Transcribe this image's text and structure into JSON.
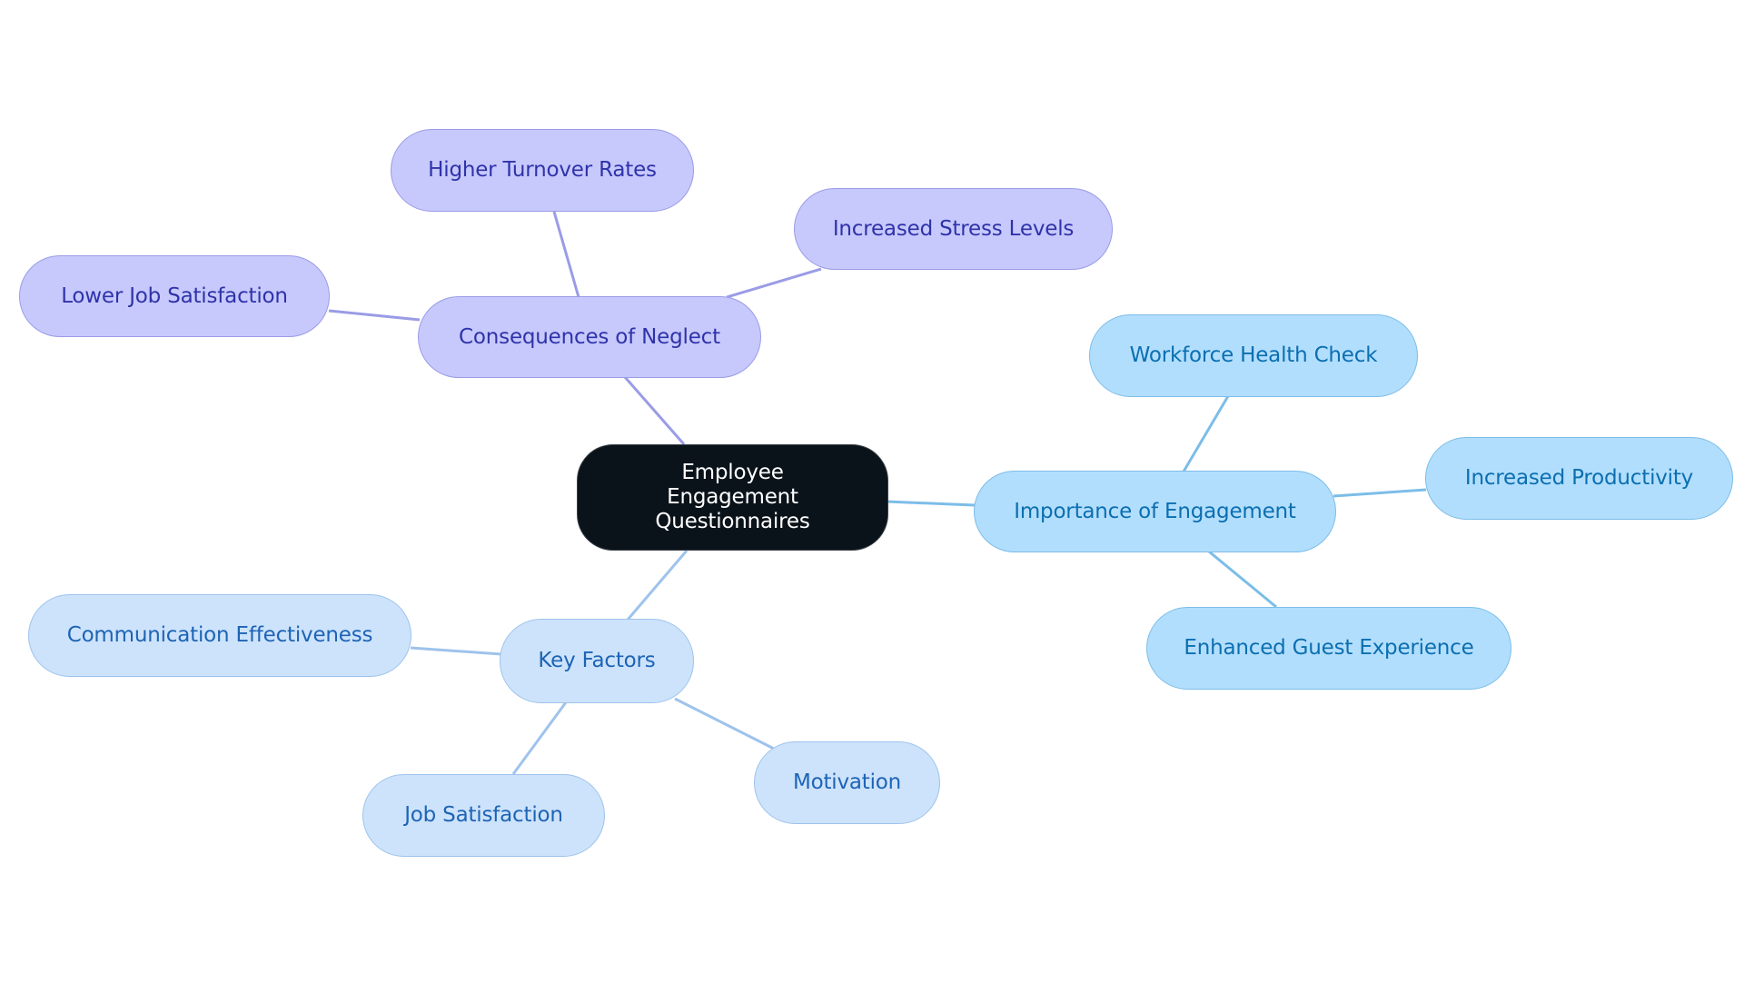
{
  "diagram": {
    "type": "mind-map",
    "root": {
      "id": "root",
      "label": "Employee Engagement Questionnaires"
    },
    "colors": {
      "root_fill": "#0b131a",
      "root_text": "#ffffff",
      "purple_fill": "#c7c9fd",
      "purple_stroke": "#9a9ce6",
      "purple_text": "#2f33a8",
      "sky_fill": "#b2defd",
      "sky_stroke": "#7cbde8",
      "sky_text": "#0b6fb0",
      "pale_fill": "#cde3fb",
      "pale_stroke": "#9ec3ec",
      "pale_text": "#1d64b5"
    },
    "branches": [
      {
        "id": "consequences",
        "label": "Consequences of Neglect",
        "theme": "purple",
        "children": [
          {
            "id": "turnover",
            "label": "Higher Turnover Rates"
          },
          {
            "id": "stress",
            "label": "Increased Stress Levels"
          },
          {
            "id": "lower-sat",
            "label": "Lower Job Satisfaction"
          }
        ]
      },
      {
        "id": "importance",
        "label": "Importance of Engagement",
        "theme": "sky",
        "children": [
          {
            "id": "health",
            "label": "Workforce Health Check"
          },
          {
            "id": "productivity",
            "label": "Increased Productivity"
          },
          {
            "id": "guest",
            "label": "Enhanced Guest Experience"
          }
        ]
      },
      {
        "id": "key-factors",
        "label": "Key Factors",
        "theme": "pale",
        "children": [
          {
            "id": "communication",
            "label": "Communication Effectiveness"
          },
          {
            "id": "job-sat",
            "label": "Job Satisfaction"
          },
          {
            "id": "motivation",
            "label": "Motivation"
          }
        ]
      }
    ]
  }
}
